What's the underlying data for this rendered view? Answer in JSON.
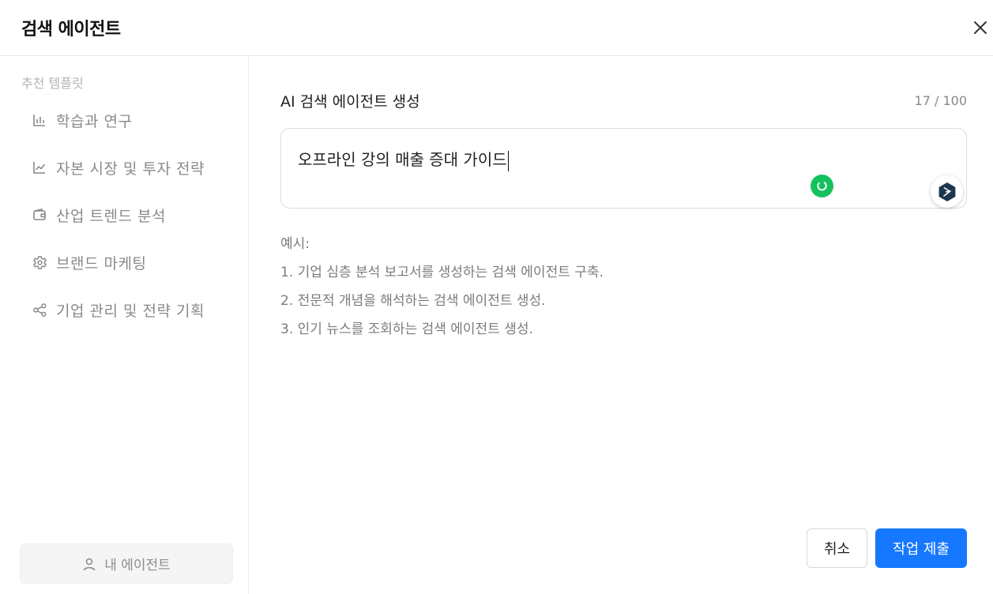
{
  "dialog": {
    "title": "검색 에이전트",
    "close_icon": "close-icon"
  },
  "sidebar": {
    "heading": "추천 템플릿",
    "items": [
      {
        "label": "학습과 연구",
        "icon": "bar-chart-icon"
      },
      {
        "label": "자본 시장 및 투자 전략",
        "icon": "line-chart-icon"
      },
      {
        "label": "산업 트렌드 분석",
        "icon": "wallet-icon"
      },
      {
        "label": "브랜드 마케팅",
        "icon": "gear-icon"
      },
      {
        "label": "기업 관리 및 전략 기획",
        "icon": "share-icon"
      }
    ],
    "my_agent": {
      "label": "내 에이전트",
      "icon": "user-icon"
    }
  },
  "main": {
    "field_label": "AI 검색 에이전트 생성",
    "char_count": "17 / 100",
    "input_value": "오프라인 강의 매출 증대 가이드",
    "examples": {
      "title": "예시:",
      "items": [
        "1. 기업 심층 분석 보고서를 생성하는 검색 에이전트 구축.",
        "2. 전문적 개념을 해석하는 검색 에이전트 생성.",
        "3. 인기 뉴스를 조회하는 검색 에이전트 생성."
      ]
    }
  },
  "footer": {
    "cancel_label": "취소",
    "submit_label": "작업 제출"
  },
  "colors": {
    "primary": "#1677ff",
    "grammar_green": "#15c15d",
    "muted_text": "#8a8a8a",
    "assist_icon_dark": "#1e3550"
  }
}
